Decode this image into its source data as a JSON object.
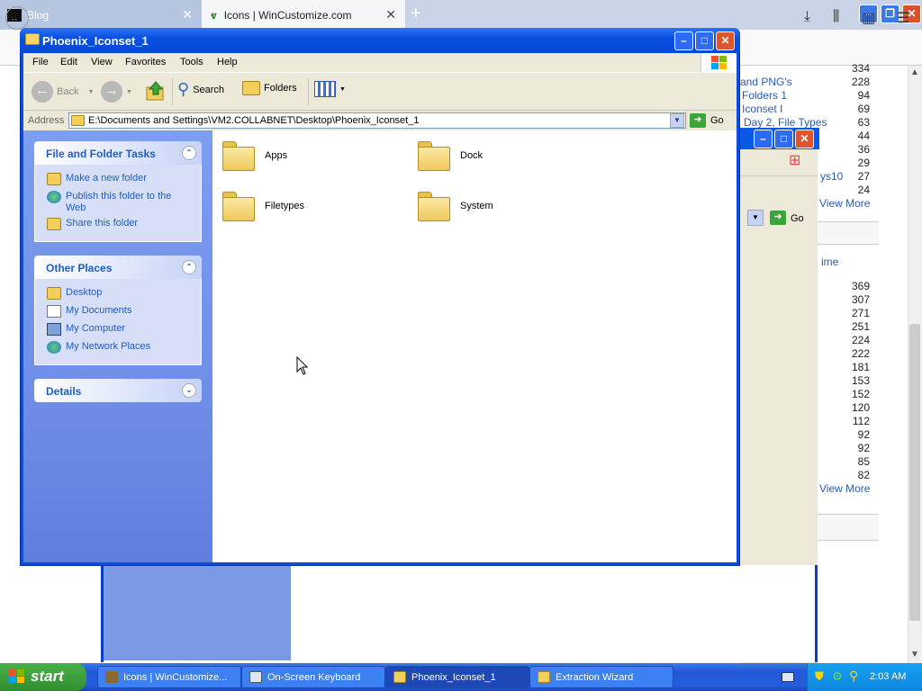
{
  "firefox": {
    "tabs": [
      {
        "label": "Blog"
      },
      {
        "label": "Icons | WinCustomize.com"
      }
    ],
    "new_tab_glyph": "+",
    "right_list": [
      {
        "label": "",
        "count": "334"
      },
      {
        "label": "and PNG's",
        "count": "228"
      },
      {
        "label": "Folders 1",
        "count": "94"
      },
      {
        "label": "Iconset I",
        "count": "69"
      },
      {
        "label": "Day 2, File Types",
        "count": "63"
      },
      {
        "label": "",
        "count": "44"
      },
      {
        "label": "",
        "count": "36"
      },
      {
        "label": "",
        "count": "29"
      },
      {
        "label": "ys10",
        "count": "27"
      },
      {
        "label": "",
        "count": "24"
      }
    ],
    "view_more_1": "View More",
    "time_header": "ime",
    "right_list2": [
      "369",
      "307",
      "271",
      "251",
      "224",
      "222",
      "181",
      "153",
      "152",
      "120",
      "112",
      "92",
      "92",
      "85",
      "82"
    ],
    "view_more_2": "View More"
  },
  "wizard": {
    "go_label": "Go"
  },
  "explorer": {
    "title": "Phoenix_Iconset_1",
    "menu": [
      "File",
      "Edit",
      "View",
      "Favorites",
      "Tools",
      "Help"
    ],
    "toolbar": {
      "back": "Back",
      "search": "Search",
      "folders": "Folders"
    },
    "address_label": "Address",
    "address_value": "E:\\Documents and Settings\\VM2.COLLABNET\\Desktop\\Phoenix_Iconset_1",
    "go_label": "Go",
    "panels": {
      "tasks": {
        "title": "File and Folder Tasks",
        "items": [
          "Make a new folder",
          "Publish this folder to the Web",
          "Share this folder"
        ]
      },
      "places": {
        "title": "Other Places",
        "items": [
          "Desktop",
          "My Documents",
          "My Computer",
          "My Network Places"
        ]
      },
      "details": {
        "title": "Details"
      }
    },
    "folders": [
      "Apps",
      "Dock",
      "Filetypes",
      "System"
    ]
  },
  "taskbar": {
    "start": "start",
    "items": [
      "Icons | WinCustomize...",
      "On-Screen Keyboard",
      "Phoenix_Iconset_1",
      "Extraction Wizard"
    ],
    "clock": "2:03 AM"
  },
  "icons": {
    "back": "back-arrow-icon",
    "forward": "forward-arrow-icon",
    "up": "folder-up-icon",
    "search": "search-icon",
    "folders": "folders-icon",
    "views": "views-icon"
  },
  "colors": {
    "xp_blue": "#0a4ee0",
    "task_pane": "#6f8ee8",
    "link_blue": "#215dc6",
    "start_green": "#2f8f2f"
  }
}
